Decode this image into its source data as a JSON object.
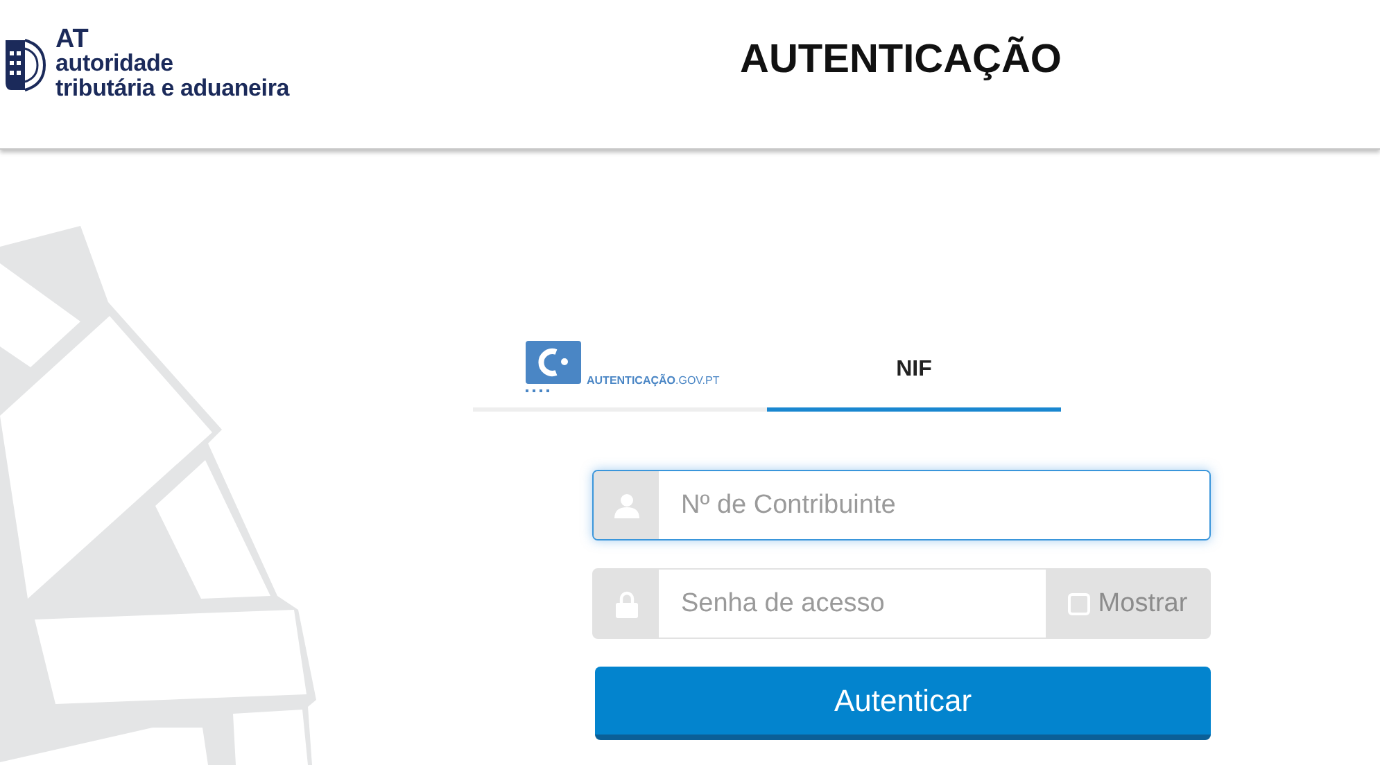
{
  "header": {
    "logo": {
      "abbr": "AT",
      "line1": "autoridade",
      "line2": "tributária e aduaneira"
    },
    "title": "AUTENTICAÇÃO"
  },
  "tabs": [
    {
      "kind": "logo",
      "label": "**AUTENTICAÇÃO**.GOV.PT",
      "selected": false
    },
    {
      "kind": "text",
      "label": "NIF",
      "selected": true
    }
  ],
  "fields": [
    {
      "kind": "user",
      "placeholder": "Nº de Contribuinte",
      "focused": true
    },
    {
      "kind": "password",
      "placeholder": "Senha de acesso",
      "focused": false,
      "show_label": "Mostrar",
      "show_checked": false
    }
  ],
  "button": {
    "label": "Autenticar"
  }
}
